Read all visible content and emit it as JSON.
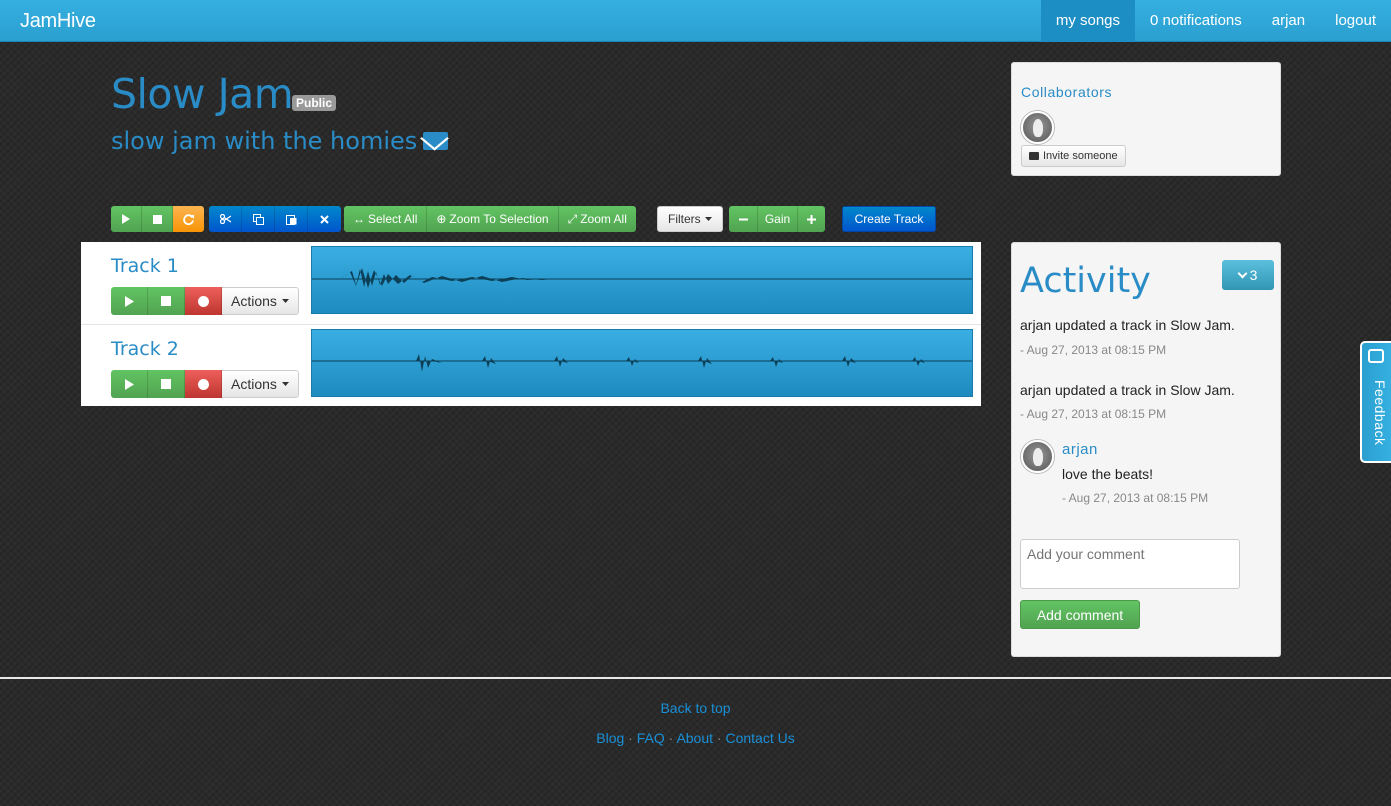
{
  "nav": {
    "brand": "JamHive",
    "items": [
      {
        "label": "my songs",
        "active": true
      },
      {
        "label": "0 notifications"
      },
      {
        "label": "arjan"
      },
      {
        "label": "logout"
      }
    ]
  },
  "song": {
    "title": "Slow Jam",
    "visibility": "Public",
    "description": "slow jam with the homies"
  },
  "toolbar": {
    "select_all": "Select All",
    "zoom_selection": "Zoom To Selection",
    "zoom_all": "Zoom All",
    "filters": "Filters",
    "gain": "Gain",
    "create_track": "Create Track"
  },
  "tracks": [
    {
      "name": "Track 1",
      "actions": "Actions"
    },
    {
      "name": "Track 2",
      "actions": "Actions"
    }
  ],
  "collaborators": {
    "title": "Collaborators",
    "invite": "Invite someone"
  },
  "activity": {
    "title": "Activity",
    "count": "3",
    "items": [
      {
        "text": "arjan updated a track in Slow Jam.",
        "time": "- Aug 27, 2013 at 08:15 PM"
      },
      {
        "text": "arjan updated a track in Slow Jam.",
        "time": "- Aug 27, 2013 at 08:15 PM"
      }
    ],
    "comment": {
      "user": "arjan",
      "text": "love the beats!",
      "time": "- Aug 27, 2013 at 08:15 PM"
    },
    "placeholder": "Add your comment",
    "add_button": "Add comment"
  },
  "feedback": "Feedback",
  "footer": {
    "back_to_top": "Back to top",
    "links": [
      "Blog",
      "FAQ",
      "About",
      "Contact Us"
    ]
  },
  "colors": {
    "brand_blue": "#2a8cc6",
    "nav_blue": "#35b0e0",
    "success_green": "#51a351",
    "danger_red": "#bd362f",
    "warning_orange": "#f89406"
  }
}
